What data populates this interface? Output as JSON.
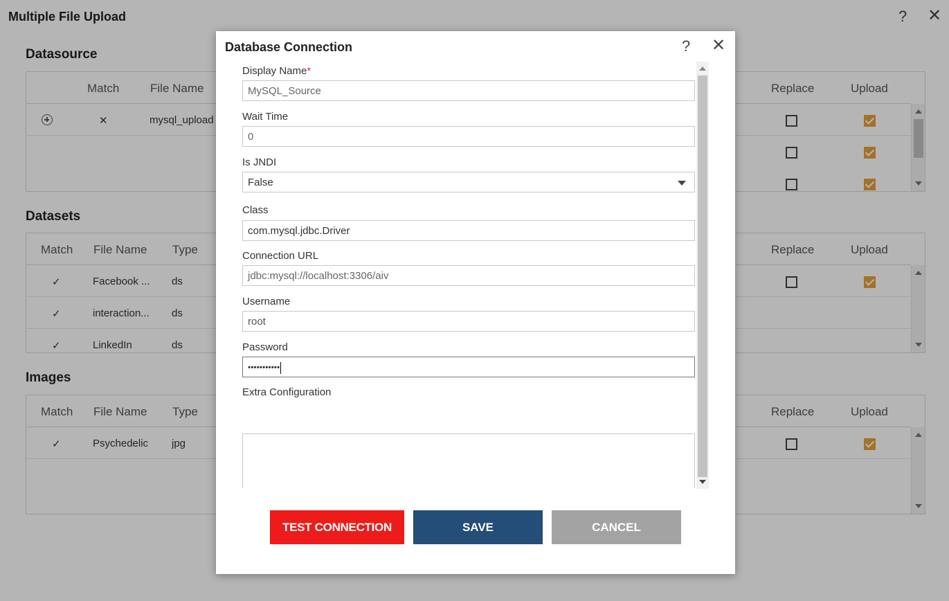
{
  "background": {
    "title": "Multiple File Upload",
    "help_glyph": "?",
    "close_glyph": "✕",
    "datasource": {
      "title": "Datasource",
      "columns": [
        "Match",
        "File Name",
        "Replace",
        "Upload"
      ],
      "rows": [
        {
          "match": "✕",
          "file_name": "mysql_upload"
        }
      ]
    },
    "datasets": {
      "title": "Datasets",
      "columns": [
        "Match",
        "File Name",
        "Type",
        "Replace",
        "Upload"
      ],
      "rows": [
        {
          "match": "✓",
          "file_name": "Facebook ...",
          "type": "ds"
        },
        {
          "match": "✓",
          "file_name": "interaction...",
          "type": "ds"
        },
        {
          "match": "✓",
          "file_name": "LinkedIn",
          "type": "ds"
        }
      ]
    },
    "images": {
      "title": "Images",
      "columns": [
        "Match",
        "File Name",
        "Type",
        "Replace",
        "Upload"
      ],
      "rows": [
        {
          "match": "✓",
          "file_name": "Psychedelic",
          "type": "jpg"
        }
      ]
    }
  },
  "modal": {
    "title": "Database Connection",
    "help_glyph": "?",
    "close_glyph": "✕",
    "fields": {
      "display_name": {
        "label": "Display Name",
        "required": "*",
        "value": "MySQL_Source"
      },
      "wait_time": {
        "label": "Wait Time",
        "value": "0"
      },
      "is_jndi": {
        "label": "Is JNDI",
        "value": "False"
      },
      "class": {
        "label": "Class",
        "value": "com.mysql.jdbc.Driver"
      },
      "connection_url": {
        "label": "Connection URL",
        "value": "jdbc:mysql://localhost:3306/aiv"
      },
      "username": {
        "label": "Username",
        "value": "root"
      },
      "password": {
        "label": "Password",
        "value": "•••••••••••"
      },
      "extra_configuration": {
        "label": "Extra Configuration",
        "value": ""
      }
    },
    "buttons": {
      "test": "TEST CONNECTION",
      "save": "SAVE",
      "cancel": "CANCEL"
    }
  },
  "colors": {
    "test_button": "#ee1b1b",
    "save_button": "#244d77",
    "cancel_button": "#a3a3a3",
    "upload_checked": "#e8a03a",
    "match_ok": "#3fa13f",
    "match_fail": "#d33333"
  }
}
